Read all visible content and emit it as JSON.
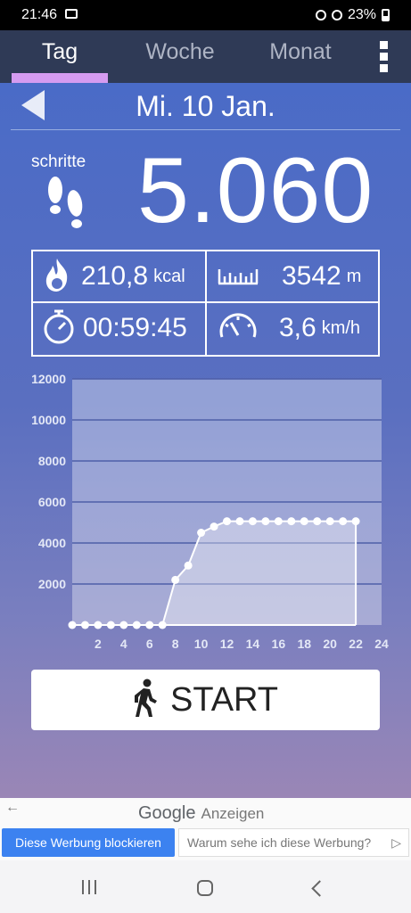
{
  "status_bar": {
    "time": "21:46",
    "battery": "23%"
  },
  "tabs": [
    {
      "label": "Tag",
      "active": true
    },
    {
      "label": "Woche",
      "active": false
    },
    {
      "label": "Monat",
      "active": false
    }
  ],
  "date_nav": {
    "date": "Mi. 10 Jan."
  },
  "steps": {
    "label": "schritte",
    "value": "5.060"
  },
  "stats": {
    "calories": {
      "value": "210,8",
      "unit": "kcal"
    },
    "distance": {
      "value": "3542",
      "unit": "m"
    },
    "duration": {
      "value": "00:59:45"
    },
    "speed": {
      "value": "3,6",
      "unit": "km/h"
    }
  },
  "chart_data": {
    "type": "area",
    "title": "",
    "xlabel": "",
    "ylabel": "",
    "x": [
      0,
      1,
      2,
      3,
      4,
      5,
      6,
      7,
      8,
      9,
      10,
      11,
      12,
      13,
      14,
      15,
      16,
      17,
      18,
      19,
      20,
      21,
      22
    ],
    "values": [
      0,
      0,
      0,
      0,
      0,
      0,
      0,
      0,
      2200,
      2900,
      4500,
      4800,
      5060,
      5060,
      5060,
      5060,
      5060,
      5060,
      5060,
      5060,
      5060,
      5060,
      5060
    ],
    "xlim": [
      0,
      24
    ],
    "ylim": [
      0,
      12000
    ],
    "x_ticks": [
      "2",
      "4",
      "6",
      "8",
      "10",
      "12",
      "14",
      "16",
      "18",
      "20",
      "22",
      "24"
    ],
    "y_ticks": [
      "2000",
      "4000",
      "6000",
      "8000",
      "10000",
      "12000"
    ],
    "grid": true
  },
  "start_button": {
    "label": "START"
  },
  "ad": {
    "brand": "Google",
    "label": "Anzeigen",
    "block_button": "Diese Werbung blockieren",
    "why_link": "Warum sehe ich diese Werbung?"
  },
  "colors": {
    "tab_bar": "#2f3a56",
    "tab_indicator": "#d59bf0",
    "accent_blue": "#3c82f0"
  }
}
